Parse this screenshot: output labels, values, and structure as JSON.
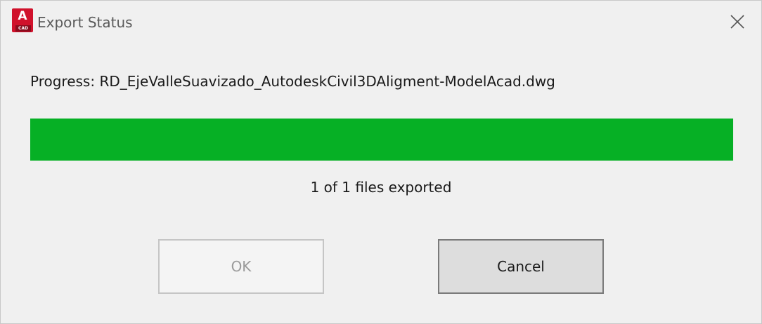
{
  "window": {
    "title": "Export Status",
    "app_icon": {
      "name": "autocad-icon",
      "letter": "A",
      "badge": "CAD",
      "color": "#d0112b"
    },
    "close_icon": "close-icon"
  },
  "progress": {
    "label": "Progress: RD_EjeValleSuavizado_AutodeskCivil3DAligment-ModelAcad.dwg",
    "fraction": 1.0,
    "bar_color": "#06b025"
  },
  "status": {
    "text": "1 of 1 files exported"
  },
  "buttons": {
    "ok_label": "OK",
    "ok_enabled": false,
    "cancel_label": "Cancel"
  }
}
